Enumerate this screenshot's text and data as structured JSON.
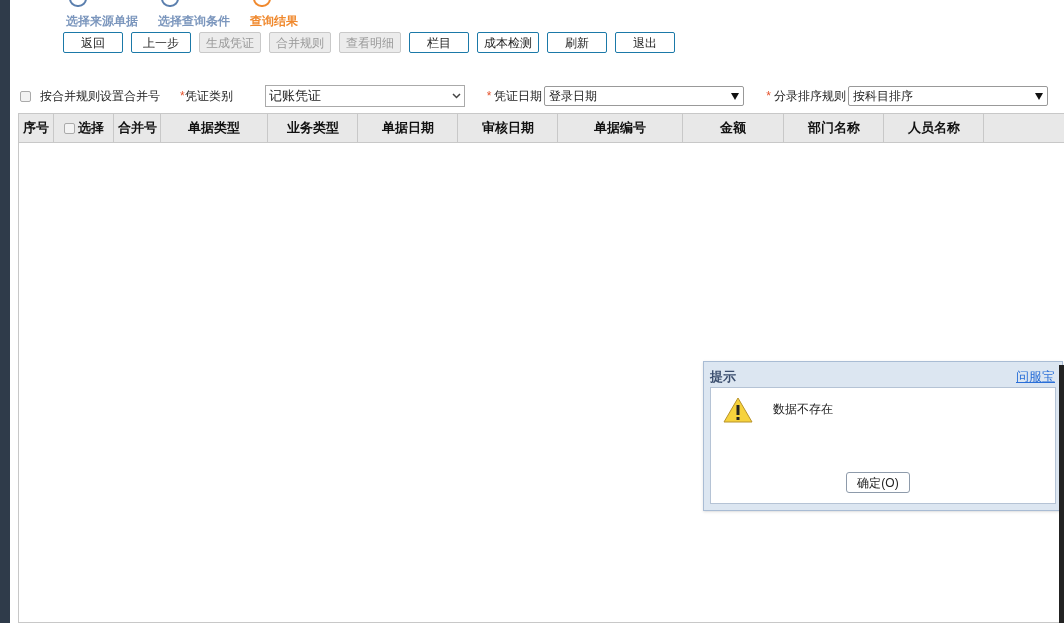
{
  "steps": [
    {
      "label": "选择来源单据",
      "current": false
    },
    {
      "label": "选择查询条件",
      "current": false
    },
    {
      "label": "查询结果",
      "current": true
    }
  ],
  "buttons": [
    {
      "label": "返回",
      "disabled": false
    },
    {
      "label": "上一步",
      "disabled": false
    },
    {
      "label": "生成凭证",
      "disabled": true
    },
    {
      "label": "合并规则",
      "disabled": true
    },
    {
      "label": "查看明细",
      "disabled": true
    },
    {
      "label": "栏目",
      "disabled": false
    },
    {
      "label": "成本检测",
      "disabled": false
    },
    {
      "label": "刷新",
      "disabled": false
    },
    {
      "label": "退出",
      "disabled": false
    }
  ],
  "merge_option": {
    "label": "按合并规则设置合并号",
    "checked": false
  },
  "filters": [
    {
      "required_mark": "*",
      "label": "凭证类别",
      "value": "记账凭证",
      "kind": "chevron"
    },
    {
      "required_mark": "*",
      "label": "凭证日期",
      "value": "登录日期",
      "kind": "triangle"
    },
    {
      "required_mark": "*",
      "label": "分录排序规则",
      "value": "按科目排序",
      "kind": "triangle"
    }
  ],
  "table": {
    "columns": [
      {
        "label": "序号",
        "kind": "text"
      },
      {
        "label": "选择",
        "kind": "checkbox",
        "checked": false
      },
      {
        "label": "合并号",
        "kind": "text"
      },
      {
        "label": "单据类型",
        "kind": "text"
      },
      {
        "label": "业务类型",
        "kind": "text"
      },
      {
        "label": "单据日期",
        "kind": "text"
      },
      {
        "label": "审核日期",
        "kind": "text"
      },
      {
        "label": "单据编号",
        "kind": "text"
      },
      {
        "label": "金额",
        "kind": "text"
      },
      {
        "label": "部门名称",
        "kind": "text"
      },
      {
        "label": "人员名称",
        "kind": "text"
      }
    ]
  },
  "dialog": {
    "title": "提示",
    "link": "问服宝",
    "message": "数据不存在",
    "button": "确定(O)"
  }
}
